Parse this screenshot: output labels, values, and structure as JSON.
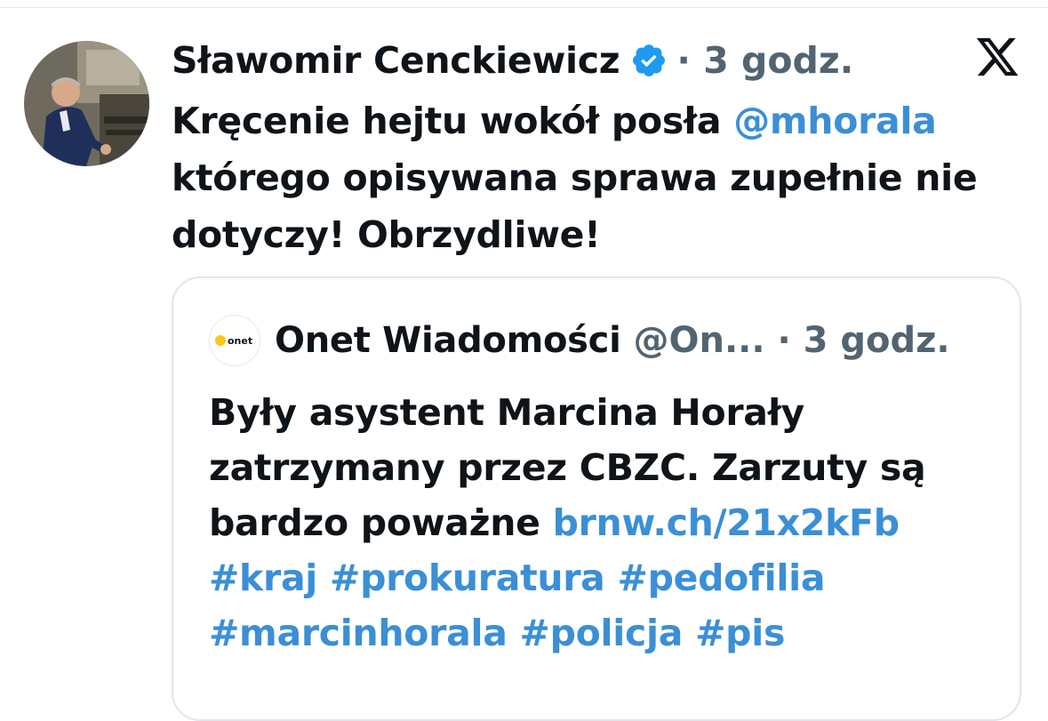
{
  "tweet": {
    "author_name": "Sławomir Cenckiewicz",
    "time_meta": "· 3 godz.",
    "text_line1_prefix": "Kręcenie hejtu wokół posła ",
    "mention": "@mhorala",
    "text_line2": "którego opisywana sprawa zupełnie nie",
    "text_line3": "dotyczy! Obrzydliwe!"
  },
  "quoted": {
    "avatar_logo_text": "onet",
    "author_name": "Onet Wiadomości",
    "meta": "@On... · 3 godz.",
    "line1": "Były asystent Marcina Horały",
    "line2": "zatrzymany przez CBZC. Zarzuty są",
    "line3_prefix": "bardzo poważne ",
    "link": "brnw.ch/21x2kFb",
    "hashtags_line1": "#kraj #prokuratura #pedofilia",
    "hashtags_line2": "#marcinhorala #policja #pis"
  },
  "colors": {
    "link": "#3b8fd6",
    "meta_gray": "#536471",
    "verified_blue": "#1d9bf0",
    "onet_yellow": "#f6c81b"
  },
  "icons": [
    "verified-badge-icon",
    "x-logo-icon"
  ]
}
